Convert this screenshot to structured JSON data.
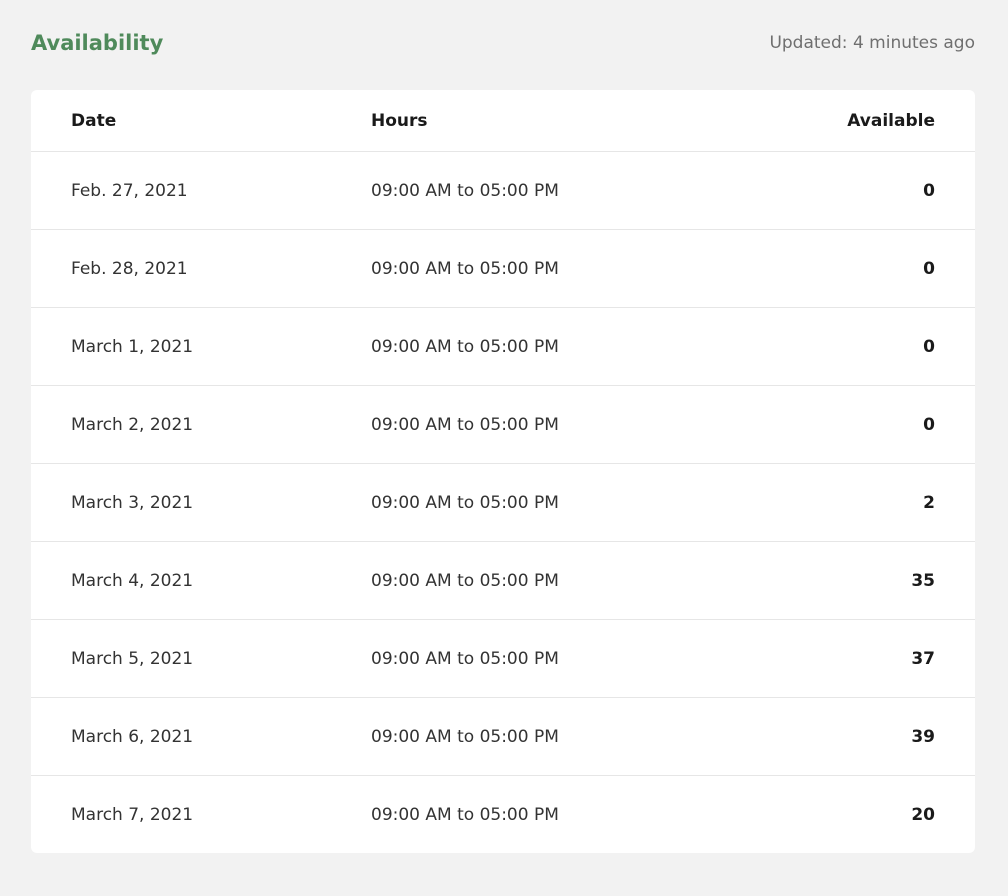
{
  "header": {
    "title": "Availability",
    "updated": "Updated: 4 minutes ago"
  },
  "table": {
    "columns": {
      "date": "Date",
      "hours": "Hours",
      "available": "Available"
    },
    "rows": [
      {
        "date": "Feb. 27, 2021",
        "hours": "09:00 AM to 05:00 PM",
        "available": "0"
      },
      {
        "date": "Feb. 28, 2021",
        "hours": "09:00 AM to 05:00 PM",
        "available": "0"
      },
      {
        "date": "March 1, 2021",
        "hours": "09:00 AM to 05:00 PM",
        "available": "0"
      },
      {
        "date": "March 2, 2021",
        "hours": "09:00 AM to 05:00 PM",
        "available": "0"
      },
      {
        "date": "March 3, 2021",
        "hours": "09:00 AM to 05:00 PM",
        "available": "2"
      },
      {
        "date": "March 4, 2021",
        "hours": "09:00 AM to 05:00 PM",
        "available": "35"
      },
      {
        "date": "March 5, 2021",
        "hours": "09:00 AM to 05:00 PM",
        "available": "37"
      },
      {
        "date": "March 6, 2021",
        "hours": "09:00 AM to 05:00 PM",
        "available": "39"
      },
      {
        "date": "March 7, 2021",
        "hours": "09:00 AM to 05:00 PM",
        "available": "20"
      }
    ]
  },
  "colors": {
    "accent": "#4f8a5b",
    "background": "#f2f2f2",
    "card": "#ffffff"
  }
}
